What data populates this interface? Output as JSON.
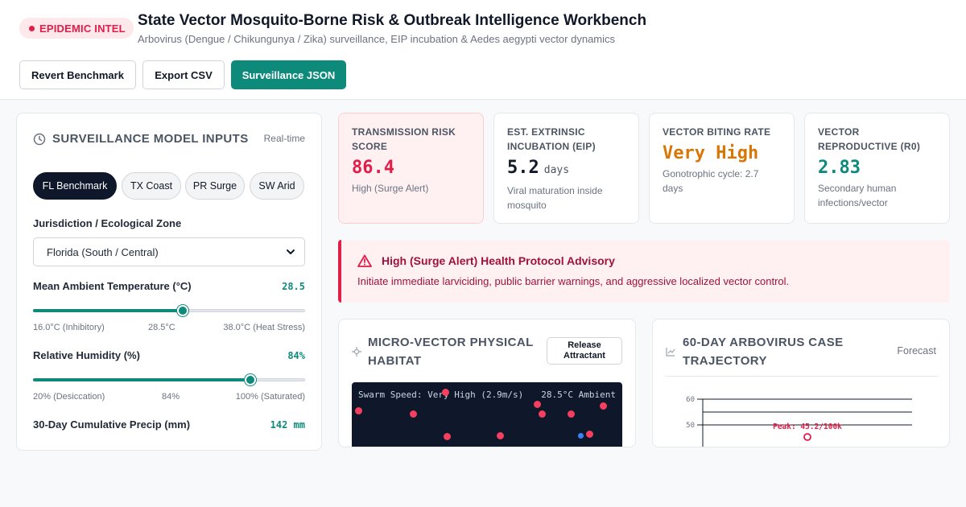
{
  "header": {
    "badge": "EPIDEMIC INTEL",
    "title": "State Vector Mosquito-Borne Risk & Outbreak Intelligence Workbench",
    "subtitle": "Arbovirus (Dengue / Chikungunya / Zika) surveillance, EIP incubation & Aedes aegypti vector dynamics",
    "buttons": {
      "revert": "Revert Benchmark",
      "export": "Export CSV",
      "json": "Surveillance JSON"
    }
  },
  "inputs": {
    "title": "SURVEILLANCE MODEL INPUTS",
    "mode": "Real-time",
    "presets": [
      "FL Benchmark",
      "TX Coast",
      "PR Surge",
      "SW Arid"
    ],
    "active_preset": 0,
    "jurisdiction": {
      "label": "Jurisdiction / Ecological Zone",
      "value": "Florida (South / Central)"
    },
    "temperature": {
      "label": "Mean Ambient Temperature (°C)",
      "value": "28.5",
      "fraction": 0.55,
      "tick_min": "16.0°C (Inhibitory)",
      "tick_mid": "28.5°C",
      "tick_max": "38.0°C (Heat Stress)"
    },
    "humidity": {
      "label": "Relative Humidity (%)",
      "value": "84%",
      "fraction": 0.8,
      "tick_min": "20% (Desiccation)",
      "tick_mid": "84%",
      "tick_max": "100% (Saturated)"
    },
    "precip": {
      "label": "30-Day Cumulative Precip (mm)",
      "value": "142 mm"
    }
  },
  "kpis": {
    "risk": {
      "label": "TRANSMISSION RISK SCORE",
      "value": "86.4",
      "sub": "High (Surge Alert)",
      "color": "#e11d48"
    },
    "eip": {
      "label": "EST. EXTRINSIC INCUBATION (EIP)",
      "value": "5.2",
      "unit": "days",
      "sub": "Viral maturation inside mosquito",
      "color": "#111827"
    },
    "biting": {
      "label": "VECTOR BITING RATE",
      "value": "Very High",
      "sub": "Gonotrophic cycle: 2.7 days",
      "color": "#d97706"
    },
    "r0": {
      "label": "VECTOR REPRODUCTIVE (R0)",
      "value": "2.83",
      "sub": "Secondary human infections/vector",
      "color": "#0e8a7b"
    }
  },
  "advisory": {
    "title": "High (Surge Alert) Health Protocol Advisory",
    "body": "Initiate immediate larviciding, public barrier warnings, and aggressive localized vector control."
  },
  "habitat": {
    "title": "MICRO-VECTOR PHYSICAL HABITAT",
    "button": "Release Attractant",
    "speed_text": "Swarm Speed: Very High (2.9m/s)",
    "ambient_text": "28.5°C Ambient"
  },
  "trajectory": {
    "title": "60-DAY ARBOVIRUS CASE TRAJECTORY",
    "mode": "Forecast"
  },
  "chart_data": {
    "type": "line",
    "title": "60-DAY ARBOVIRUS CASE TRAJECTORY",
    "ylim": [
      0,
      60
    ],
    "yticks": [
      "60",
      "50"
    ],
    "annotation": "Peak: 45.2/100k",
    "peak": 45.2
  }
}
